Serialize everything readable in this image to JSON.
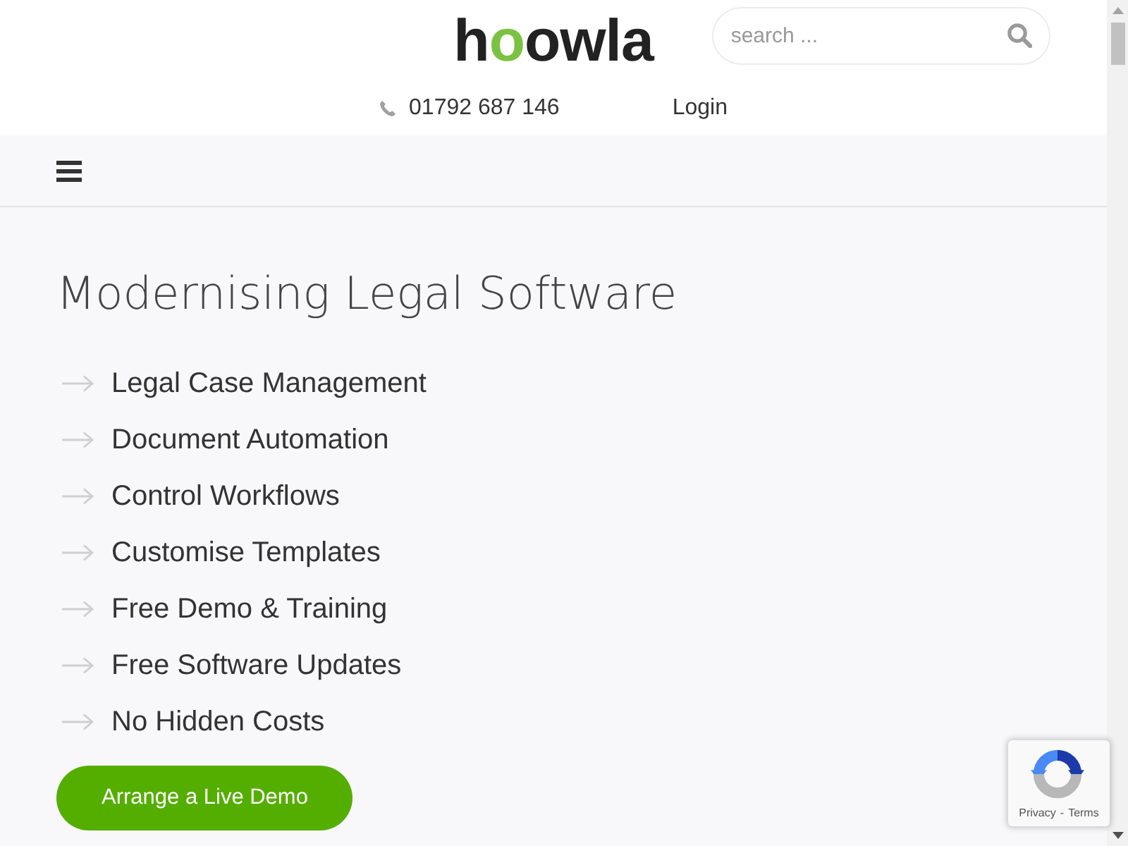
{
  "header": {
    "logo": "hoowla",
    "search": {
      "placeholder": "search ..."
    },
    "phone": "01792 687 146",
    "login": "Login"
  },
  "hero": {
    "title": "Modernising Legal Software",
    "features": [
      "Legal Case Management",
      "Document Automation",
      "Control Workflows",
      "Customise Templates",
      "Free Demo & Training",
      "Free Software Updates",
      "No Hidden Costs"
    ],
    "cta": "Arrange a Live Demo"
  },
  "recaptcha": {
    "privacy": "Privacy",
    "separator": "-",
    "terms": "Terms"
  }
}
